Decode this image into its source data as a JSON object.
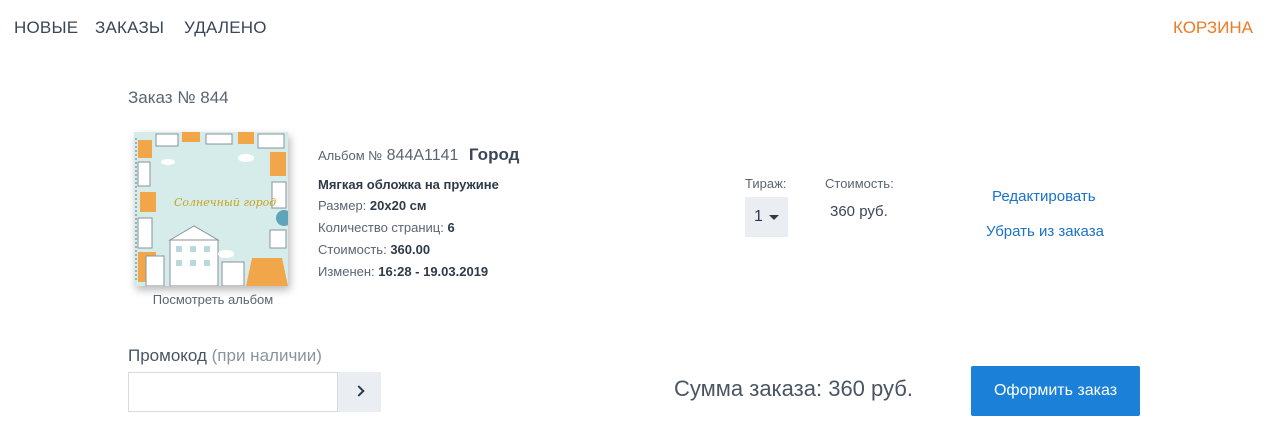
{
  "nav": {
    "tabs": [
      {
        "label": "НОВЫЕ"
      },
      {
        "label": "ЗАКАЗЫ"
      },
      {
        "label": "УДАЛЕНО"
      }
    ],
    "cart_label": "КОРЗИНА"
  },
  "order": {
    "title": "Заказ № 844"
  },
  "album": {
    "cover_text": "Солнечный город",
    "view_label": "Посмотреть альбом",
    "number_label": "Альбом №",
    "number": "844A1141",
    "name": "Город",
    "cover_type": "Мягкая обложка на пружине",
    "specs": [
      {
        "key": "Размер:",
        "value": "20x20 см"
      },
      {
        "key": "Количество страниц:",
        "value": "6"
      },
      {
        "key": "Стоимость:",
        "value": "360.00"
      },
      {
        "key": "Изменен:",
        "value": "16:28 - 19.03.2019"
      }
    ]
  },
  "quantity": {
    "label": "Тираж:",
    "value": "1"
  },
  "cost": {
    "label": "Стоимость:",
    "value": "360 руб."
  },
  "actions": {
    "edit": "Редактировать",
    "remove": "Убрать из заказа"
  },
  "promo": {
    "label": "Промокод",
    "hint": "(при наличии)",
    "value": "",
    "placeholder": ""
  },
  "summary": {
    "total": "Сумма заказа: 360 руб.",
    "checkout_label": "Оформить заказ"
  },
  "colors": {
    "accent_blue": "#1a80d8",
    "link_blue": "#1a72c9",
    "cart_orange": "#ee7a22",
    "text_dark": "#3b4656"
  }
}
